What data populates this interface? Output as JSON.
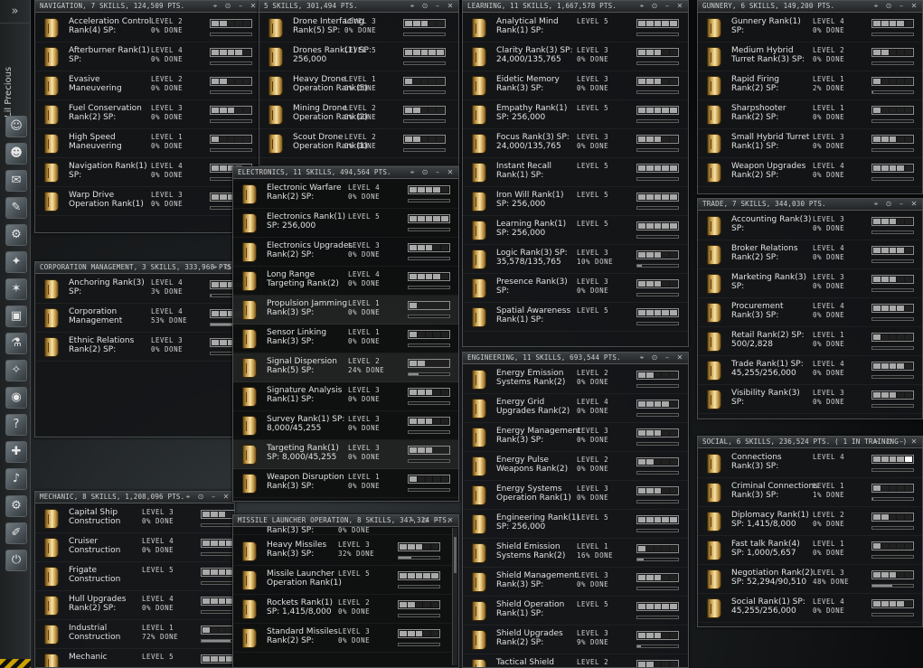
{
  "sidebar": {
    "expand_glyph": "»",
    "character_name": "Lil Precious",
    "icons": [
      "character-sheet-icon",
      "people-and-places-icon",
      "mail-icon",
      "notepad-icon",
      "assets-icon",
      "map-icon",
      "starmap-icon",
      "market-icon",
      "science-industry-icon",
      "corporation-icon",
      "browser-icon",
      "help-icon",
      "fitting-icon",
      "music-icon",
      "settings-icon",
      "journal-icon",
      "log-off-icon"
    ]
  },
  "windows": [
    {
      "id": "navigation",
      "title": "NAVIGATION, 7 SKILLS, 124,509 PTS.",
      "skills": [
        {
          "l1": "Acceleration Control",
          "l2": "Rank(4) SP:",
          "level": "LEVEL 2",
          "done": "0% DONE",
          "lvl": 2,
          "pct": 0
        },
        {
          "l1": "Afterburner Rank(1)",
          "l2": "SP:",
          "level": "LEVEL 4",
          "done": "0% DONE",
          "lvl": 4,
          "pct": 0
        },
        {
          "l1": "Evasive",
          "l2": "Maneuvering",
          "level": "LEVEL 2",
          "done": "0% DONE",
          "lvl": 2,
          "pct": 0
        },
        {
          "l1": "Fuel Conservation",
          "l2": "Rank(2) SP:",
          "level": "LEVEL 3",
          "done": "0% DONE",
          "lvl": 3,
          "pct": 0
        },
        {
          "l1": "High Speed",
          "l2": "Maneuvering",
          "level": "LEVEL 1",
          "done": "0% DONE",
          "lvl": 1,
          "pct": 0
        },
        {
          "l1": "Navigation Rank(1)",
          "l2": "SP:",
          "level": "LEVEL 4",
          "done": "0% DONE",
          "lvl": 4,
          "pct": 0
        },
        {
          "l1": "Warp Drive",
          "l2": "Operation Rank(1)",
          "level": "LEVEL 3",
          "done": "0% DONE",
          "lvl": 3,
          "pct": 0
        }
      ]
    },
    {
      "id": "drones",
      "title": "5 SKILLS, 301,494 PTS.",
      "skills": [
        {
          "l1": "Drone Interfacing",
          "l2": "Rank(5) SP:",
          "level": "LEVEL 3",
          "done": "0% DONE",
          "lvl": 3,
          "pct": 0
        },
        {
          "l1": "Drones Rank(1) SP:",
          "l2": "256,000",
          "level": "LEVEL 5",
          "done": "",
          "lvl": 5,
          "pct": 0
        },
        {
          "l1": "Heavy Drone",
          "l2": "Operation Rank(5)",
          "level": "LEVEL 1",
          "done": "0% DONE",
          "lvl": 1,
          "pct": 0
        },
        {
          "l1": "Mining Drone",
          "l2": "Operation Rank(2)",
          "level": "LEVEL 2",
          "done": "0% DONE",
          "lvl": 2,
          "pct": 0
        },
        {
          "l1": "Scout Drone",
          "l2": "Operation Rank(1)",
          "level": "LEVEL 2",
          "done": "0% DONE",
          "lvl": 2,
          "pct": 0
        }
      ]
    },
    {
      "id": "corporation",
      "title": "CORPORATION MANAGEMENT, 3 SKILLS, 333,968 PTS.",
      "skills": [
        {
          "l1": "Anchoring Rank(3)",
          "l2": "SP:",
          "level": "LEVEL 4",
          "done": "3% DONE",
          "lvl": 4,
          "pct": 3
        },
        {
          "l1": "Corporation",
          "l2": "Management",
          "level": "LEVEL 4",
          "done": "53% DONE",
          "lvl": 4,
          "pct": 53
        },
        {
          "l1": "Ethnic Relations",
          "l2": "Rank(2) SP:",
          "level": "LEVEL 3",
          "done": "0% DONE",
          "lvl": 3,
          "pct": 0
        }
      ]
    },
    {
      "id": "mechanic",
      "title": "MECHANIC, 8 SKILLS, 1,208,096 PTS.",
      "skills": [
        {
          "l1": "Capital Ship",
          "l2": "Construction",
          "level": "LEVEL 3",
          "done": "0% DONE",
          "lvl": 3,
          "pct": 0
        },
        {
          "l1": "Cruiser",
          "l2": "Construction",
          "level": "LEVEL 4",
          "done": "0% DONE",
          "lvl": 4,
          "pct": 0
        },
        {
          "l1": "Frigate",
          "l2": "Construction",
          "level": "LEVEL 5",
          "done": "",
          "lvl": 5,
          "pct": 0
        },
        {
          "l1": "Hull Upgrades",
          "l2": "Rank(2) SP:",
          "level": "LEVEL 4",
          "done": "0% DONE",
          "lvl": 4,
          "pct": 0
        },
        {
          "l1": "Industrial",
          "l2": "Construction",
          "level": "LEVEL 1",
          "done": "72% DONE",
          "lvl": 1,
          "pct": 72
        },
        {
          "l1": "Mechanic",
          "l2": "",
          "level": "LEVEL 5",
          "done": "",
          "lvl": 5,
          "pct": 0
        }
      ]
    },
    {
      "id": "electronics",
      "title": "ELECTRONICS, 11 SKILLS, 494,564 PTS.",
      "skills": [
        {
          "l1": "Electronic Warfare",
          "l2": "Rank(2) SP:",
          "level": "LEVEL 4",
          "done": "0% DONE",
          "lvl": 4,
          "pct": 0
        },
        {
          "l1": "Electronics Rank(1)",
          "l2": "SP: 256,000",
          "level": "LEVEL 5",
          "done": "",
          "lvl": 5,
          "pct": 0
        },
        {
          "l1": "Electronics Upgrades",
          "l2": "Rank(2) SP:",
          "level": "LEVEL 3",
          "done": "0% DONE",
          "lvl": 3,
          "pct": 0
        },
        {
          "l1": "Long Range",
          "l2": "Targeting Rank(2)",
          "level": "LEVEL 4",
          "done": "0% DONE",
          "lvl": 4,
          "pct": 0
        },
        {
          "l1": "Propulsion Jamming",
          "l2": "Rank(3) SP:",
          "level": "LEVEL 1",
          "done": "0% DONE",
          "lvl": 1,
          "pct": 0
        },
        {
          "l1": "Sensor Linking",
          "l2": "Rank(3) SP:",
          "level": "LEVEL 1",
          "done": "0% DONE",
          "lvl": 1,
          "pct": 0
        },
        {
          "l1": "Signal Dispersion",
          "l2": "Rank(5) SP:",
          "level": "LEVEL 2",
          "done": "24% DONE",
          "lvl": 2,
          "pct": 24
        },
        {
          "l1": "Signature Analysis",
          "l2": "Rank(1) SP:",
          "level": "LEVEL 3",
          "done": "0% DONE",
          "lvl": 3,
          "pct": 0
        },
        {
          "l1": "Survey Rank(1) SP:",
          "l2": "8,000/45,255",
          "level": "LEVEL 3",
          "done": "0% DONE",
          "lvl": 3,
          "pct": 0
        },
        {
          "l1": "Targeting Rank(1)",
          "l2": "SP: 8,000/45,255",
          "level": "LEVEL 3",
          "done": "0% DONE",
          "lvl": 3,
          "pct": 0
        },
        {
          "l1": "Weapon Disruption",
          "l2": "Rank(3) SP:",
          "level": "LEVEL 1",
          "done": "0% DONE",
          "lvl": 1,
          "pct": 0
        }
      ]
    },
    {
      "id": "missile",
      "title": "MISSILE LAUNCHER OPERATION, 8 SKILLS, 347,324 PTS.",
      "partial": {
        "text": "Rank(3) SP:",
        "done": "0% DONE"
      },
      "skills": [
        {
          "l1": "Heavy Missiles",
          "l2": "Rank(3) SP:",
          "level": "LEVEL 3",
          "done": "32% DONE",
          "lvl": 3,
          "pct": 32
        },
        {
          "l1": "Missile Launcher",
          "l2": "Operation Rank(1)",
          "level": "LEVEL 5",
          "done": "",
          "lvl": 5,
          "pct": 0
        },
        {
          "l1": "Rockets Rank(1)",
          "l2": "SP: 1,415/8,000",
          "level": "LEVEL 2",
          "done": "0% DONE",
          "lvl": 2,
          "pct": 0
        },
        {
          "l1": "Standard Missiles",
          "l2": "Rank(2) SP:",
          "level": "LEVEL 3",
          "done": "0% DONE",
          "lvl": 3,
          "pct": 0
        }
      ]
    },
    {
      "id": "learning",
      "title": "LEARNING, 11 SKILLS, 1,667,578 PTS.",
      "skills": [
        {
          "l1": "Analytical Mind",
          "l2": "Rank(1) SP:",
          "level": "LEVEL 5",
          "done": "",
          "lvl": 5,
          "pct": 0
        },
        {
          "l1": "Clarity Rank(3) SP:",
          "l2": "24,000/135,765",
          "level": "LEVEL 3",
          "done": "0% DONE",
          "lvl": 3,
          "pct": 0
        },
        {
          "l1": "Eidetic Memory",
          "l2": "Rank(3) SP:",
          "level": "LEVEL 3",
          "done": "0% DONE",
          "lvl": 3,
          "pct": 0
        },
        {
          "l1": "Empathy Rank(1)",
          "l2": "SP: 256,000",
          "level": "LEVEL 5",
          "done": "",
          "lvl": 5,
          "pct": 0
        },
        {
          "l1": "Focus Rank(3) SP:",
          "l2": "24,000/135,765",
          "level": "LEVEL 3",
          "done": "0% DONE",
          "lvl": 3,
          "pct": 0
        },
        {
          "l1": "Instant Recall",
          "l2": "Rank(1) SP:",
          "level": "LEVEL 5",
          "done": "",
          "lvl": 5,
          "pct": 0
        },
        {
          "l1": "Iron Will Rank(1)",
          "l2": "SP: 256,000",
          "level": "LEVEL 5",
          "done": "",
          "lvl": 5,
          "pct": 0
        },
        {
          "l1": "Learning Rank(1)",
          "l2": "SP: 256,000",
          "level": "LEVEL 5",
          "done": "",
          "lvl": 5,
          "pct": 0
        },
        {
          "l1": "Logic Rank(3) SP:",
          "l2": "35,578/135,765",
          "level": "LEVEL 3",
          "done": "10% DONE",
          "lvl": 3,
          "pct": 10
        },
        {
          "l1": "Presence Rank(3)",
          "l2": "SP:",
          "level": "LEVEL 3",
          "done": "0% DONE",
          "lvl": 3,
          "pct": 0
        },
        {
          "l1": "Spatial Awareness",
          "l2": "Rank(1) SP:",
          "level": "LEVEL 5",
          "done": "",
          "lvl": 5,
          "pct": 0
        }
      ]
    },
    {
      "id": "engineering",
      "title": "ENGINEERING, 11 SKILLS, 693,544 PTS.",
      "skills": [
        {
          "l1": "Energy Emission",
          "l2": "Systems Rank(2)",
          "level": "LEVEL 2",
          "done": "0% DONE",
          "lvl": 2,
          "pct": 0
        },
        {
          "l1": "Energy Grid",
          "l2": "Upgrades Rank(2)",
          "level": "LEVEL 4",
          "done": "0% DONE",
          "lvl": 4,
          "pct": 0
        },
        {
          "l1": "Energy Management",
          "l2": "Rank(3) SP:",
          "level": "LEVEL 3",
          "done": "0% DONE",
          "lvl": 3,
          "pct": 0
        },
        {
          "l1": "Energy Pulse",
          "l2": "Weapons Rank(2)",
          "level": "LEVEL 2",
          "done": "0% DONE",
          "lvl": 2,
          "pct": 0
        },
        {
          "l1": "Energy Systems",
          "l2": "Operation Rank(1)",
          "level": "LEVEL 3",
          "done": "0% DONE",
          "lvl": 3,
          "pct": 0
        },
        {
          "l1": "Engineering Rank(1)",
          "l2": "SP: 256,000",
          "level": "LEVEL 5",
          "done": "",
          "lvl": 5,
          "pct": 0
        },
        {
          "l1": "Shield Emission",
          "l2": "Systems Rank(2)",
          "level": "LEVEL 1",
          "done": "16% DONE",
          "lvl": 1,
          "pct": 16
        },
        {
          "l1": "Shield Management",
          "l2": "Rank(3) SP:",
          "level": "LEVEL 3",
          "done": "0% DONE",
          "lvl": 3,
          "pct": 0
        },
        {
          "l1": "Shield Operation",
          "l2": "Rank(1) SP:",
          "level": "LEVEL 5",
          "done": "",
          "lvl": 5,
          "pct": 0
        },
        {
          "l1": "Shield Upgrades",
          "l2": "Rank(2) SP:",
          "level": "LEVEL 3",
          "done": "9% DONE",
          "lvl": 3,
          "pct": 9
        },
        {
          "l1": "Tactical Shield",
          "l2": "",
          "level": "LEVEL 2",
          "done": "",
          "lvl": 2,
          "pct": 0
        }
      ]
    },
    {
      "id": "gunnery",
      "title": "GUNNERY, 6 SKILLS, 149,200 PTS.",
      "skills": [
        {
          "l1": "Gunnery Rank(1)",
          "l2": "SP:",
          "level": "LEVEL 4",
          "done": "0% DONE",
          "lvl": 4,
          "pct": 0
        },
        {
          "l1": "Medium Hybrid",
          "l2": "Turret Rank(3) SP:",
          "level": "LEVEL 2",
          "done": "0% DONE",
          "lvl": 2,
          "pct": 0
        },
        {
          "l1": "Rapid Firing",
          "l2": "Rank(2) SP:",
          "level": "LEVEL 1",
          "done": "2% DONE",
          "lvl": 1,
          "pct": 2
        },
        {
          "l1": "Sharpshooter",
          "l2": "Rank(2) SP:",
          "level": "LEVEL 1",
          "done": "0% DONE",
          "lvl": 1,
          "pct": 0
        },
        {
          "l1": "Small Hybrid Turret",
          "l2": "Rank(1) SP:",
          "level": "LEVEL 3",
          "done": "0% DONE",
          "lvl": 3,
          "pct": 0
        },
        {
          "l1": "Weapon Upgrades",
          "l2": "Rank(2) SP:",
          "level": "LEVEL 4",
          "done": "0% DONE",
          "lvl": 4,
          "pct": 0
        }
      ]
    },
    {
      "id": "trade",
      "title": "TRADE, 7 SKILLS, 344,030 PTS.",
      "skills": [
        {
          "l1": "Accounting Rank(3)",
          "l2": "SP:",
          "level": "LEVEL 3",
          "done": "0% DONE",
          "lvl": 3,
          "pct": 0
        },
        {
          "l1": "Broker Relations",
          "l2": "Rank(2) SP:",
          "level": "LEVEL 4",
          "done": "0% DONE",
          "lvl": 4,
          "pct": 0
        },
        {
          "l1": "Marketing Rank(3)",
          "l2": "SP:",
          "level": "LEVEL 3",
          "done": "0% DONE",
          "lvl": 3,
          "pct": 0
        },
        {
          "l1": "Procurement",
          "l2": "Rank(3) SP:",
          "level": "LEVEL 4",
          "done": "0% DONE",
          "lvl": 4,
          "pct": 0
        },
        {
          "l1": "Retail Rank(2) SP:",
          "l2": "500/2,828",
          "level": "LEVEL 1",
          "done": "0% DONE",
          "lvl": 1,
          "pct": 0
        },
        {
          "l1": "Trade Rank(1) SP:",
          "l2": "45,255/256,000",
          "level": "LEVEL 4",
          "done": "0% DONE",
          "lvl": 4,
          "pct": 0
        },
        {
          "l1": "Visibility Rank(3)",
          "l2": "SP:",
          "level": "LEVEL 3",
          "done": "0% DONE",
          "lvl": 3,
          "pct": 0
        }
      ]
    },
    {
      "id": "social",
      "title": "SOCIAL, 6 SKILLS, 236,524 PTS. ( 1 IN TRAINING )",
      "skills": [
        {
          "l1": "Connections",
          "l2": "Rank(3) SP:",
          "level": "LEVEL 4",
          "done": "",
          "lvl": 4,
          "pct": 0,
          "training": true
        },
        {
          "l1": "Criminal Connections",
          "l2": "Rank(3) SP:",
          "level": "LEVEL 1",
          "done": "1% DONE",
          "lvl": 1,
          "pct": 1
        },
        {
          "l1": "Diplomacy Rank(1)",
          "l2": "SP: 1,415/8,000",
          "level": "LEVEL 2",
          "done": "0% DONE",
          "lvl": 2,
          "pct": 0
        },
        {
          "l1": "Fast talk Rank(4)",
          "l2": "SP: 1,000/5,657",
          "level": "LEVEL 1",
          "done": "0% DONE",
          "lvl": 1,
          "pct": 0
        },
        {
          "l1": "Negotiation Rank(2)",
          "l2": "SP: 52,294/90,510",
          "level": "LEVEL 3",
          "done": "48% DONE",
          "lvl": 3,
          "pct": 48
        },
        {
          "l1": "Social Rank(1) SP:",
          "l2": "45,255/256,000",
          "level": "LEVEL 4",
          "done": "0% DONE",
          "lvl": 4,
          "pct": 0
        }
      ]
    }
  ]
}
